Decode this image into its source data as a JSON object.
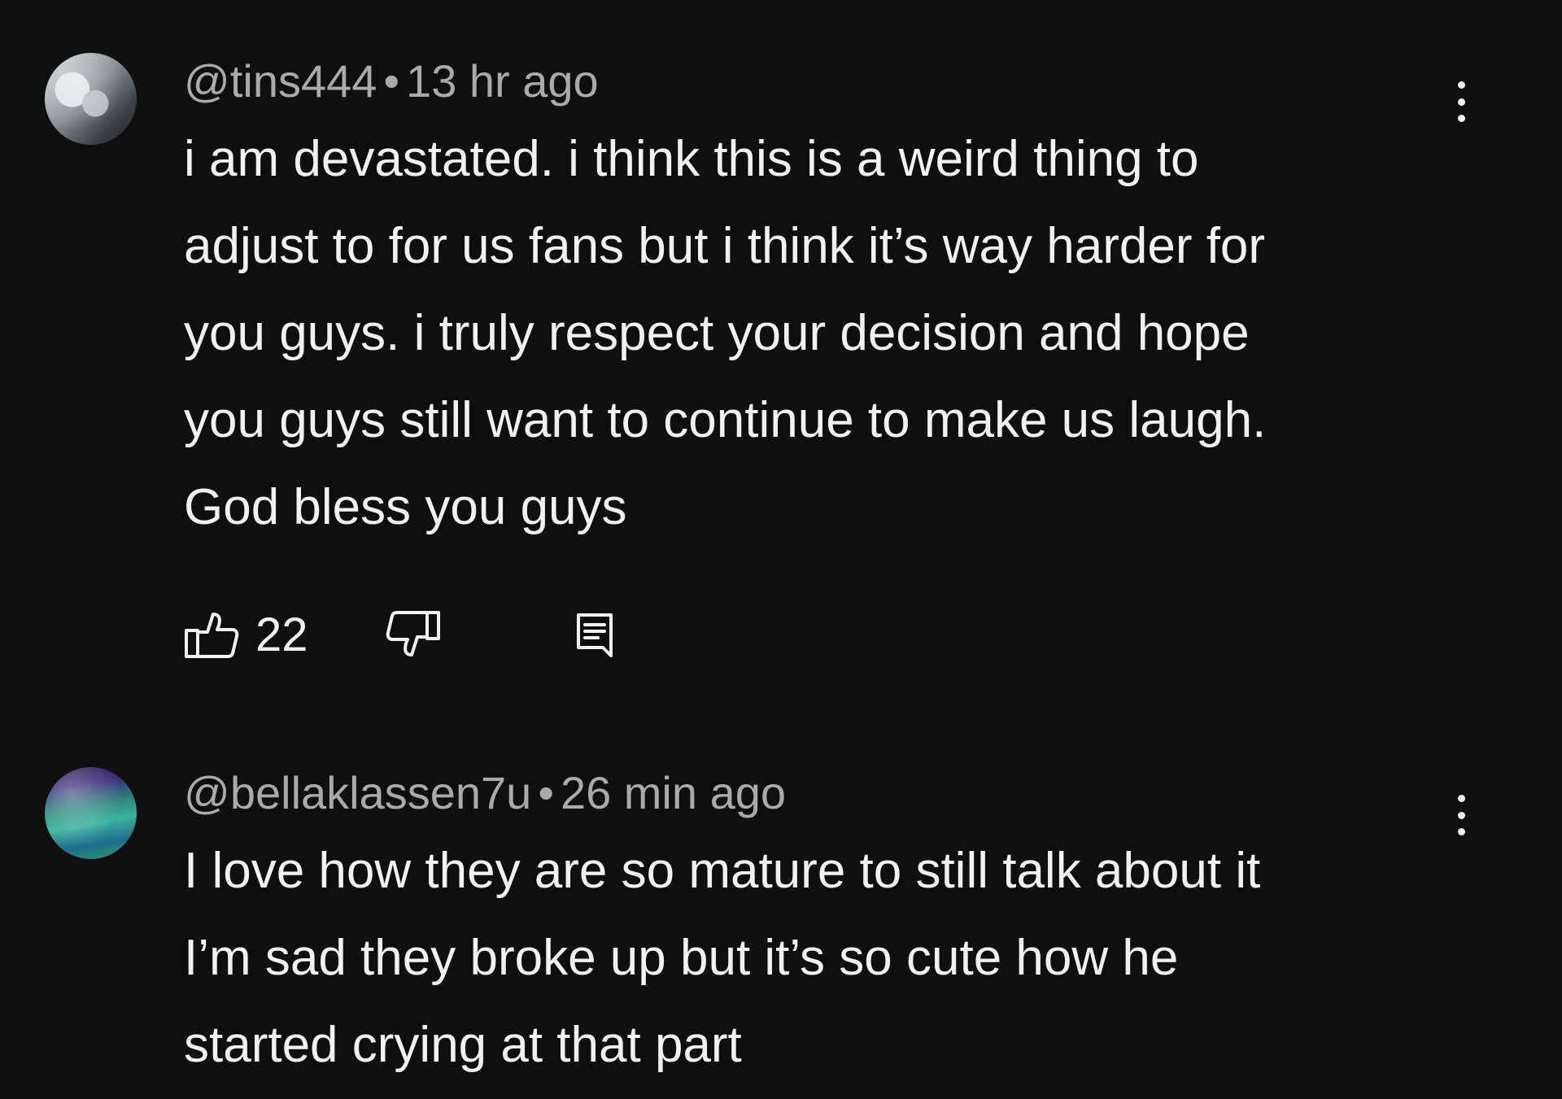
{
  "comments": [
    {
      "username": "@tins444",
      "separator": "•",
      "time": "13 hr ago",
      "lines": [
        "i am devastated. i think this is a weird thing to",
        "adjust to for us fans but i think it’s way harder for",
        "you guys. i truly respect your decision and hope",
        "you guys still want to continue to make us laugh.",
        "God bless you guys"
      ],
      "like_count": "22",
      "icons": {
        "like": "thumbs-up-icon",
        "dislike": "thumbs-down-icon",
        "reply": "reply-icon",
        "more": "more-vertical-icon"
      }
    },
    {
      "username": "@bellaklassen7u",
      "separator": "•",
      "time": "26 min ago",
      "lines": [
        "I love how they are so mature to still talk about it",
        "I’m sad they broke up but it’s so cute how he",
        "started crying at that part"
      ],
      "icons": {
        "more": "more-vertical-icon"
      }
    }
  ],
  "colors": {
    "background": "#0f0f0f",
    "text_primary": "#f1f1f1",
    "text_secondary": "#aaaaaa"
  }
}
